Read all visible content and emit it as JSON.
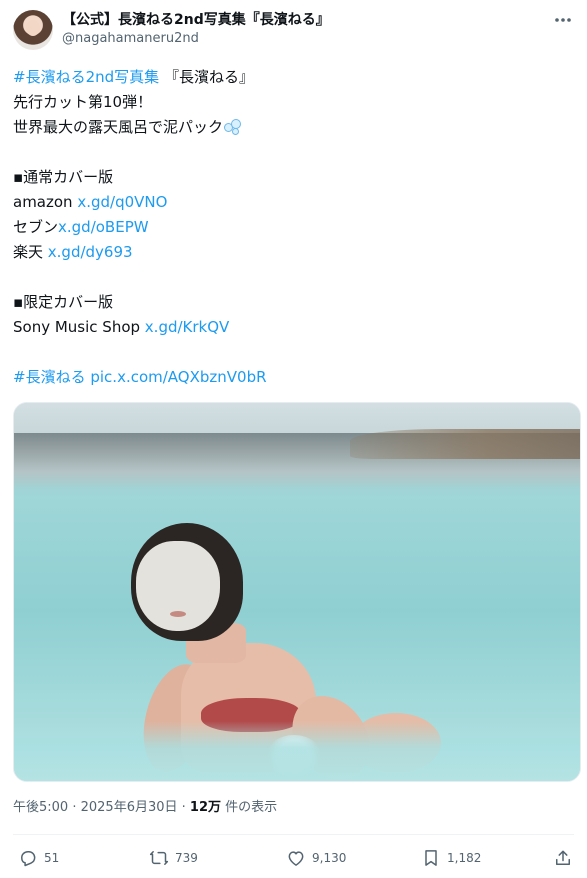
{
  "author": {
    "display_name": "【公式】長濱ねる2nd写真集『長濱ねる』",
    "handle": "@nagahamaneru2nd"
  },
  "post": {
    "line1_hashtag": "#長濱ねる2nd写真集",
    "line1_rest": "『長濱ねる』",
    "line2": "先行カット第10弾！",
    "line3": "世界最大の露天風呂で泥パック",
    "line3_emoji_icon": "bubbles-icon",
    "section1_title": "▪通常カバー版",
    "amazon_label": "amazon ",
    "amazon_link": "x.gd/q0VNO",
    "seven_label": "セブン",
    "seven_link": "x.gd/oBEPW",
    "rakuten_label": "楽天 ",
    "rakuten_link": "x.gd/dy693",
    "section2_title": "▪限定カバー版",
    "sony_label": "Sony Music Shop ",
    "sony_link": "x.gd/KrkQV",
    "footer_hashtag": "#長濱ねる",
    "footer_pic_link": "pic.x.com/AQXbznV0bR"
  },
  "meta": {
    "time": "午後5:00",
    "separator": " · ",
    "date": "2025年6月30日",
    "views_count": "12万",
    "views_label": " 件の表示"
  },
  "actions": {
    "replies": "51",
    "reposts": "739",
    "likes": "9,130",
    "bookmarks": "1,182"
  },
  "colors": {
    "link": "#1d9bf0",
    "text": "#0f1419",
    "secondary": "#536471"
  }
}
